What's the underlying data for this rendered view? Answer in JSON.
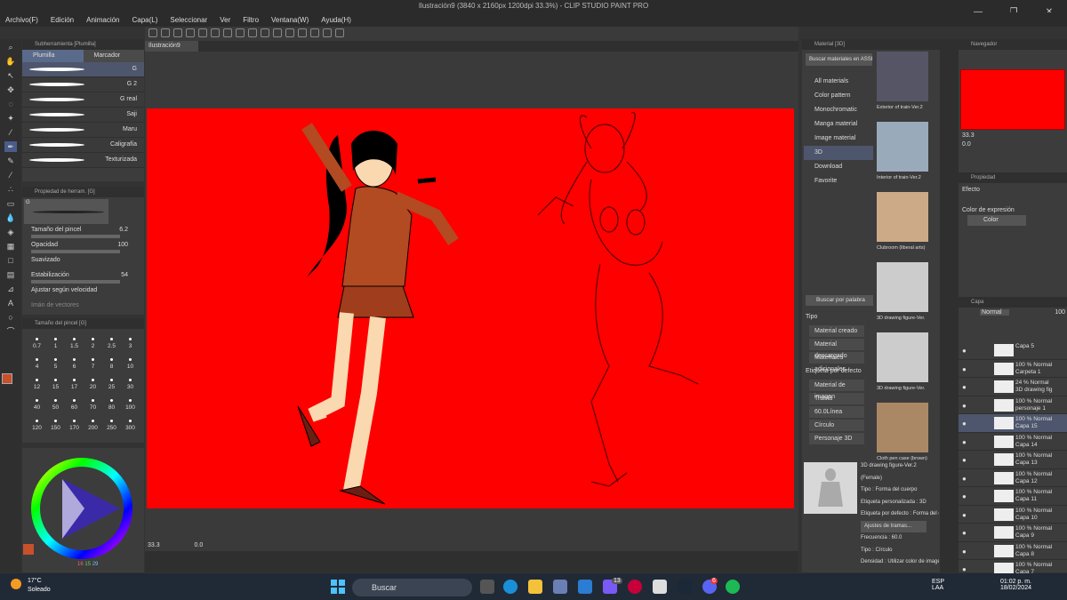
{
  "title": "Ilustración9 (3840 x 2160px 1200dpi 33.3%)  - CLIP STUDIO PAINT PRO",
  "menu": [
    "Archivo(F)",
    "Edición",
    "Animación",
    "Capa(L)",
    "Seleccionar",
    "Ver",
    "Filtro",
    "Ventana(W)",
    "Ayuda(H)"
  ],
  "subtool": {
    "header": "Subherramienta [Plumilla]",
    "tabs": [
      "Plumilla",
      "Marcador"
    ],
    "brushes": [
      "G",
      "G 2",
      "G real",
      "Saji",
      "Maru",
      "Caligrafía",
      "Texturizada"
    ]
  },
  "toolprop": {
    "header": "Propiedad de herram. [G]",
    "g_label": "G",
    "rows": [
      {
        "label": "Tamaño del pincel",
        "value": "6.2"
      },
      {
        "label": "Opacidad",
        "value": "100"
      },
      {
        "label": "Suavizado",
        "value": ""
      },
      {
        "label": "Estabilización",
        "value": "54"
      }
    ],
    "check": "Ajustar según velocidad",
    "vector": "Imán de vectores"
  },
  "brushsize": {
    "header": "Tamaño del pincel [G]",
    "sizes": [
      "0.7",
      "1",
      "1.5",
      "2",
      "2.5",
      "3",
      "4",
      "5",
      "6",
      "7",
      "8",
      "10",
      "12",
      "15",
      "17",
      "20",
      "25",
      "30",
      "40",
      "50",
      "60",
      "70",
      "80",
      "100",
      "120",
      "150",
      "170",
      "200",
      "250",
      "300"
    ]
  },
  "color": {
    "main": "#c8502a",
    "sub": "#ffffff",
    "r": "16",
    "g": "15",
    "b": "29"
  },
  "canvas": {
    "tab": "Ilustración9",
    "zoom": "33.3",
    "angle": "0.0",
    "bg": "#ff0000"
  },
  "material": {
    "header": "Material [3D]",
    "search_btn": "Buscar materiales en ASSETS",
    "tree": [
      "All materials",
      "Color pattern",
      "Monochromatic",
      "Manga material",
      "Image material",
      "3D",
      "Download",
      "Favorite"
    ],
    "thumbs": [
      "Exterior of train-Ver.2",
      "Interior of train-Ver.2",
      "Clubroom (liberal arts)",
      "3D drawing figure-Ver.",
      "3D drawing figure-Ver.",
      "Cloth pen case (brown)"
    ],
    "search_ph": "Buscar por palabra",
    "tipo": "Tipo",
    "tipo_tags": [
      "Material creado",
      "Material descargado",
      "Materiales adicionales"
    ],
    "etiqueta": "Etiqueta por defecto",
    "etiq_tags": [
      "Material de imagen",
      "Trama",
      "60.0Línea",
      "Círculo",
      "Personaje 3D"
    ],
    "detail": [
      "3D drawing figure-Ver.2 (Female)",
      "Tipo : Forma del cuerpo",
      "Etiqueta personalizada : 3D",
      "Etiqueta por defecto : Forma del cuer",
      "Ajustes de tramas...",
      "Frecuencia : 60.0",
      "Tipo : Círculo",
      "Densidad : Utilizar color de imagen"
    ]
  },
  "navigator": {
    "header": "Navegador",
    "zoom": "33.3",
    "angle": "0.0"
  },
  "propiedad": {
    "header": "Propiedad",
    "efecto": "Efecto",
    "expr_label": "Color de expresión",
    "expr_val": "Color"
  },
  "layers": {
    "header": "Capa",
    "blend": "Normal",
    "opacity": "100",
    "items": [
      {
        "t1": "",
        "t2": "Capa 5"
      },
      {
        "t1": "100 % Normal",
        "t2": "Carpeta 1"
      },
      {
        "t1": "24 % Normal",
        "t2": "3D drawing fig"
      },
      {
        "t1": "100 % Normal",
        "t2": "personaje 1"
      },
      {
        "t1": "100 % Normal",
        "t2": "Capa 15"
      },
      {
        "t1": "100 % Normal",
        "t2": "Capa 14"
      },
      {
        "t1": "100 % Normal",
        "t2": "Capa 13"
      },
      {
        "t1": "100 % Normal",
        "t2": "Capa 12"
      },
      {
        "t1": "100 % Normal",
        "t2": "Capa 11"
      },
      {
        "t1": "100 % Normal",
        "t2": "Capa 10"
      },
      {
        "t1": "100 % Normal",
        "t2": "Capa 9"
      },
      {
        "t1": "100 % Normal",
        "t2": "Capa 8"
      },
      {
        "t1": "100 % Normal",
        "t2": "Capa 7"
      }
    ]
  },
  "taskbar": {
    "temp": "17°C",
    "weather": "Soleado",
    "search": "Buscar",
    "lang1": "ESP",
    "lang2": "LAA",
    "time": "01:02 p. m.",
    "date": "18/02/2024",
    "badge1": "13",
    "badge2": "6"
  }
}
